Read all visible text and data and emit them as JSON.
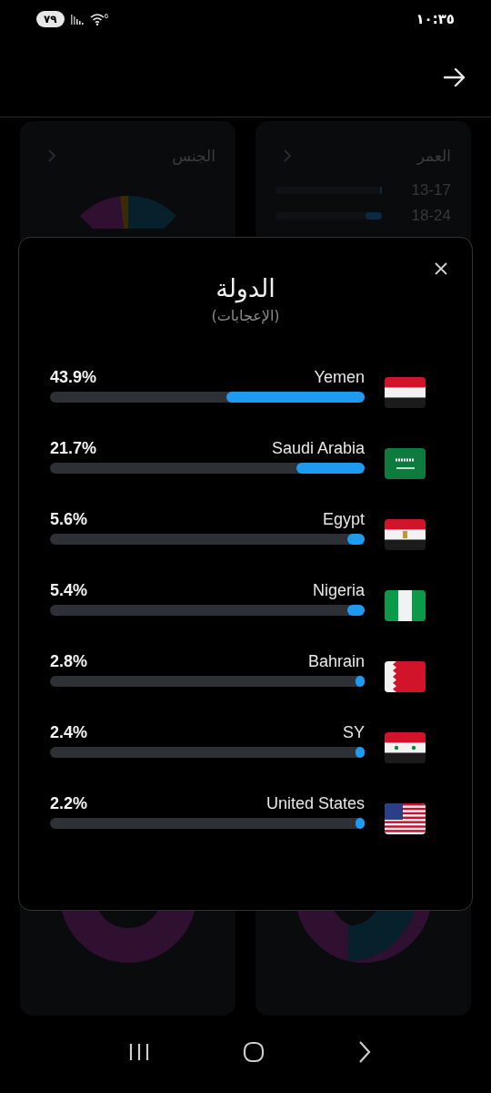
{
  "status_bar": {
    "battery": "٧٩",
    "wifi_badge": "6",
    "time": "١٠:٣٥"
  },
  "background_cards": [
    {
      "title": "العمر",
      "kind": "age",
      "rows": [
        {
          "label": "13-17",
          "level": 0.02
        },
        {
          "label": "18-24",
          "level": 0.15
        }
      ]
    },
    {
      "title": "الجنس",
      "kind": "gender"
    }
  ],
  "dialog": {
    "title": "الدولة",
    "subtitle": "(الإعجابات)",
    "countries": [
      {
        "name": "Yemen",
        "percent": "43.9%",
        "level": 0.439,
        "kind": "tricolor"
      },
      {
        "name": "Saudi Arabia",
        "percent": "21.7%",
        "level": 0.217,
        "kind": "sword"
      },
      {
        "name": "Egypt",
        "percent": "5.6%",
        "level": 0.056,
        "kind": "eagle"
      },
      {
        "name": "Nigeria",
        "percent": "5.4%",
        "level": 0.054,
        "kind": "vertical"
      },
      {
        "name": "Bahrain",
        "percent": "2.8%",
        "level": 0.028,
        "kind": "serrated"
      },
      {
        "name": "SY",
        "percent": "2.4%",
        "level": 0.024,
        "kind": "stars"
      },
      {
        "name": "United States",
        "percent": "2.2%",
        "level": 0.022,
        "kind": "stripes"
      }
    ]
  }
}
